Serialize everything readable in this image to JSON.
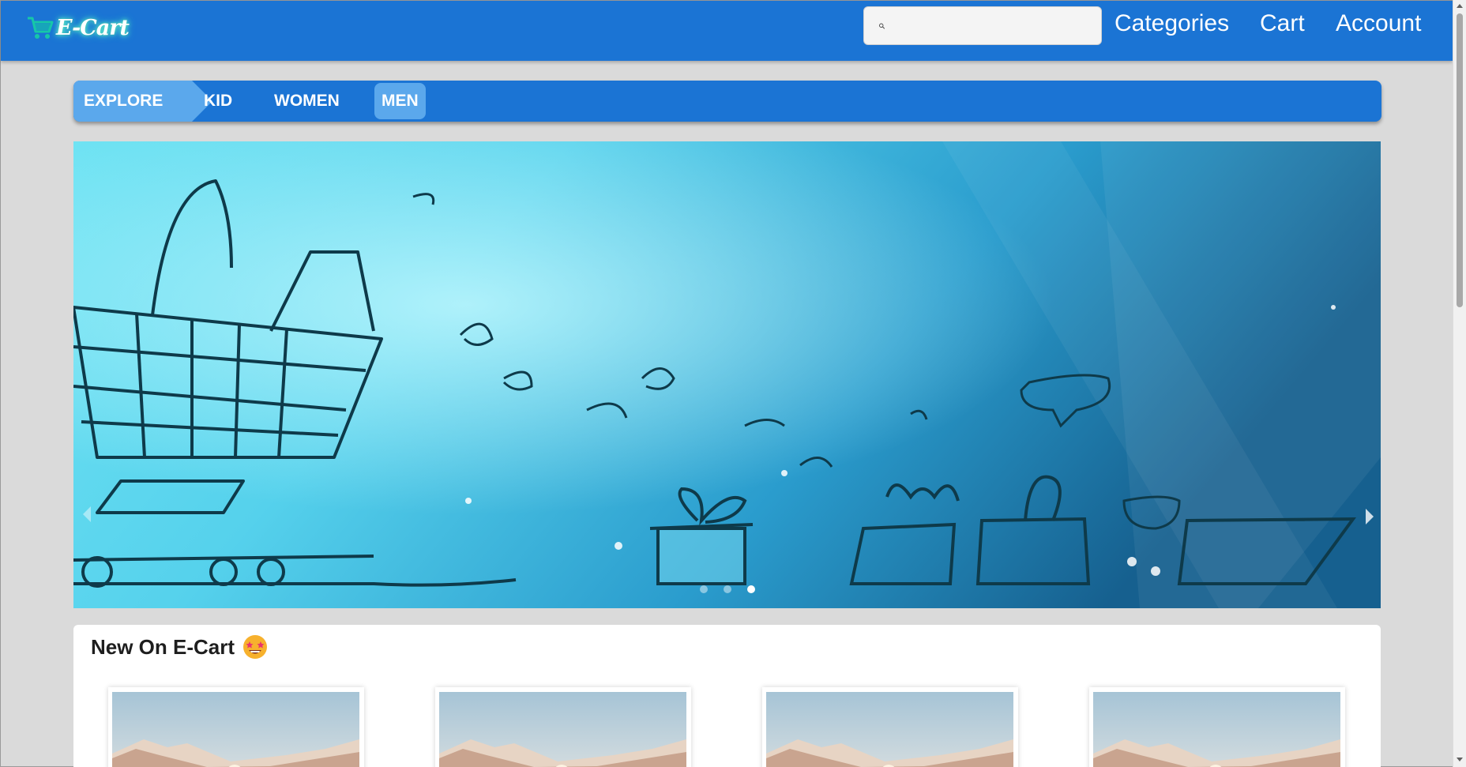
{
  "header": {
    "brand_text": "E-Cart",
    "search": {
      "placeholder": "",
      "value": ""
    },
    "nav": {
      "categories_label": "Categories",
      "cart_label": "Cart",
      "account_label": "Account"
    }
  },
  "category_bar": {
    "explore_label": "EXPLORE",
    "items": [
      {
        "label": "KID",
        "active": false
      },
      {
        "label": "WOMEN",
        "active": false
      },
      {
        "label": "MEN",
        "active": true
      }
    ]
  },
  "carousel": {
    "slide_count": 3,
    "active_slide": 3
  },
  "new_section": {
    "title": "New On E-Cart",
    "title_emoji": "star-struck-face-icon",
    "product_count_visible": 4
  },
  "colors": {
    "brand_blue": "#1b74d4",
    "accent_light_blue": "#5ba8ec",
    "page_background": "#dadada",
    "brand_glow": "#6af5d5"
  }
}
